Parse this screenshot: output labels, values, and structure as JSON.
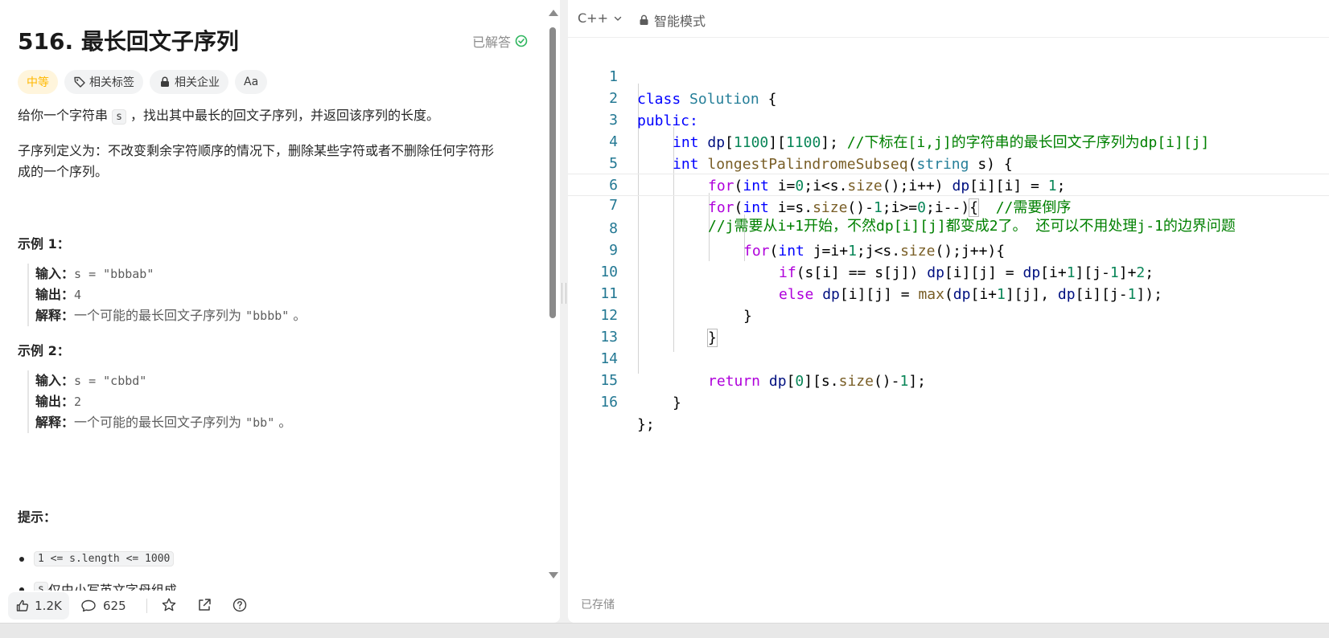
{
  "problem": {
    "title": "516. 最长回文子序列",
    "solved_label": "已解答",
    "tags": {
      "difficulty": "中等",
      "topics": "相关标签",
      "companies": "相关企业",
      "translate": "Aa"
    },
    "description": {
      "p1_before": "给你一个字符串 ",
      "p1_code": "s",
      "p1_after": " ，找出其中最长的回文子序列，并返回该序列的长度。",
      "p2": "子序列定义为：不改变剩余字符顺序的情况下，删除某些字符或者不删除任何字符形成的一个序列。"
    },
    "examples": [
      {
        "title": "示例 1：",
        "input_label": "输入：",
        "input_value": "s = \"bbbab\"",
        "output_label": "输出：",
        "output_value": "4",
        "explain_label": "解释：",
        "explain_text": "一个可能的最长回文子序列为 ",
        "explain_code": "\"bbbb\"",
        "explain_end": " 。"
      },
      {
        "title": "示例 2：",
        "input_label": "输入：",
        "input_value": "s = \"cbbd\"",
        "output_label": "输出：",
        "output_value": "2",
        "explain_label": "解释：",
        "explain_text": "一个可能的最长回文子序列为 ",
        "explain_code": "\"bb\"",
        "explain_end": " 。"
      }
    ],
    "constraints_title": "提示：",
    "constraints": [
      {
        "code": "1 <= s.length <= 1000",
        "text": ""
      },
      {
        "code": "s",
        "text": " 仅由小写英文字母组成"
      }
    ]
  },
  "bottom_bar": {
    "likes": "1.2K",
    "comments": "625"
  },
  "editor": {
    "language": "C++",
    "mode": "智能模式",
    "saved_label": "已存储",
    "line_numbers": [
      "1",
      "2",
      "3",
      "4",
      "5",
      "6",
      "7",
      "8",
      "9",
      "10",
      "11",
      "12",
      "13",
      "14",
      "15",
      "16"
    ],
    "lines": {
      "l1_k": "class",
      "l1_t": "Solution",
      "l1_r": " {",
      "l2": "public:",
      "l3_a": "int",
      "l3_b": "dp",
      "l3_c": "[",
      "l3_d": "1100",
      "l3_e": "][",
      "l3_f": "1100",
      "l3_g": "]; ",
      "l3_cm": "//下标在[i,j]的字符串的最长回文子序列为dp[i][j]",
      "l4_a": "int",
      "l4_b": "longestPalindromeSubseq",
      "l4_c": "(",
      "l4_d": "string",
      "l4_e": " s) {",
      "l5_a": "for",
      "l5_b": "(",
      "l5_c": "int",
      "l5_d": " i=",
      "l5_e": "0",
      "l5_f": ";i<s.",
      "l5_g": "size",
      "l5_h": "();i++) ",
      "l5_i": "dp",
      "l5_j": "[i][i] = ",
      "l5_k": "1",
      "l5_l": ";",
      "l6_a": "for",
      "l6_b": "(",
      "l6_c": "int",
      "l6_d": " i=s.",
      "l6_e": "size",
      "l6_f": "()-",
      "l6_g": "1",
      "l6_h": ";i>=",
      "l6_i": "0",
      "l6_j": ";i--)",
      "l6_k": "{",
      "l6_cm": "  //需要倒序",
      "l7_cm": "//j需要从i+1开始，不然dp[i][j]都变成2了。 还可以不用处理j-1的边界问题",
      "l8_a": "for",
      "l8_b": "(",
      "l8_c": "int",
      "l8_d": " j=i+",
      "l8_e": "1",
      "l8_f": ";j<s.",
      "l8_g": "size",
      "l8_h": "();j++){",
      "l9_a": "if",
      "l9_b": "(s[i] == s[j]) ",
      "l9_c": "dp",
      "l9_d": "[i][j] = ",
      "l9_e": "dp",
      "l9_f": "[i+",
      "l9_g": "1",
      "l9_h": "][j-",
      "l9_i": "1",
      "l9_j": "]+",
      "l9_k": "2",
      "l9_l": ";",
      "l10_a": "else",
      "l10_b": "dp",
      "l10_c": "[i][j] = ",
      "l10_d": "max",
      "l10_e": "(",
      "l10_f": "dp",
      "l10_g": "[i+",
      "l10_h": "1",
      "l10_i": "][j], ",
      "l10_j": "dp",
      "l10_k": "[i][j-",
      "l10_l": "1",
      "l10_m": "]);",
      "l11": "}",
      "l12": "}",
      "l14_a": "return",
      "l14_b": "dp",
      "l14_c": "[",
      "l14_d": "0",
      "l14_e": "][s.",
      "l14_f": "size",
      "l14_g": "()-",
      "l14_h": "1",
      "l14_i": "];",
      "l15": "}",
      "l16": "};"
    }
  },
  "colors": {
    "keyword": "#0000ff",
    "control": "#af00db",
    "type": "#267f99",
    "function": "#795e26",
    "variable": "#001080",
    "number": "#098658",
    "comment": "#008000",
    "line_number": "#237893",
    "difficulty_medium": "#ffb800",
    "solved_green": "#2db55d"
  }
}
